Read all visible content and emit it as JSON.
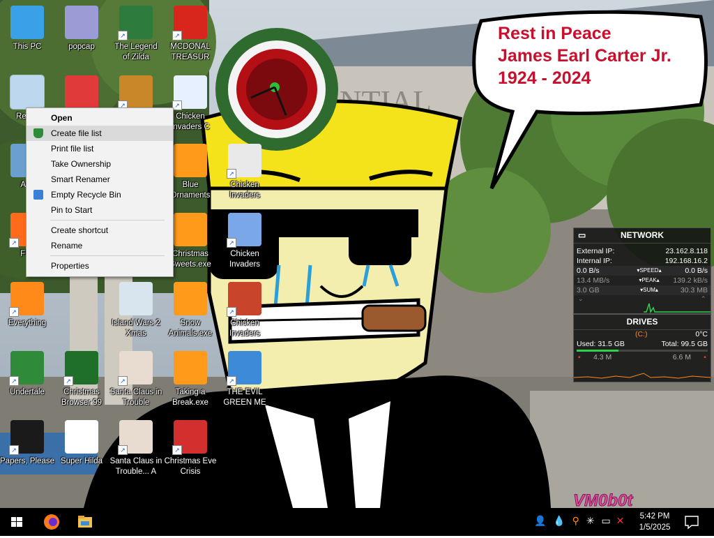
{
  "desktop": {
    "icons": [
      {
        "label": "This PC",
        "icon": "computer-icon",
        "shortcut": false
      },
      {
        "label": "popcap",
        "icon": "folder-icon",
        "shortcut": false
      },
      {
        "label": "The Legend\nof Zilda",
        "icon": "game-icon",
        "shortcut": true
      },
      {
        "label": "MCDONAL\nTREASUR",
        "icon": "mcdonalds-icon",
        "shortcut": true
      },
      {
        "label": "Recyc",
        "icon": "recycle-bin-icon",
        "shortcut": false
      },
      {
        "label": "",
        "icon": "christmas-bird-icon",
        "shortcut": false
      },
      {
        "label": "",
        "icon": "angry-birds-seasons-icon",
        "shortcut": true
      },
      {
        "label": "Chicken\nInvaders C",
        "icon": "snowman-icon",
        "shortcut": true
      },
      {
        "label": "Acti",
        "icon": "app-icon",
        "shortcut": false
      },
      {
        "label": "Blue\nOrnaments",
        "icon": "ornaments-exe-icon",
        "shortcut": false
      },
      {
        "label": "Chicken\nInvaders",
        "icon": "chicken-icon",
        "shortcut": true
      },
      {
        "label": "Fire",
        "icon": "firefox-icon",
        "shortcut": true
      },
      {
        "label": "Christmas\nSweets.exe",
        "icon": "sweets-exe-icon",
        "shortcut": false
      },
      {
        "label": "Chicken\nInvaders",
        "icon": "chicken-invaders-icon",
        "shortcut": true
      },
      {
        "label": "Everything",
        "icon": "everything-search-icon",
        "shortcut": true
      },
      {
        "label": "Island Wars 2\nXmas",
        "icon": "island-wars-icon",
        "shortcut": false
      },
      {
        "label": "Snow\nAnimals.exe",
        "icon": "snow-animals-exe-icon",
        "shortcut": false
      },
      {
        "label": "Chicken\nInvaders",
        "icon": "chicken-invaders-3-icon",
        "shortcut": true
      },
      {
        "label": "Undertale",
        "icon": "undertale-icon",
        "shortcut": true
      },
      {
        "label": "Christmas\nBrowser 99",
        "icon": "christmas-tree-icon",
        "shortcut": true
      },
      {
        "label": "Santa Claus in\nTrouble",
        "icon": "santa-icon",
        "shortcut": true
      },
      {
        "label": "Taking a\nBreak.exe",
        "icon": "break-exe-icon",
        "shortcut": false
      },
      {
        "label": "THE EVIL\nGREEN ME",
        "icon": "evil-green-icon",
        "shortcut": true
      },
      {
        "label": "Papers, Please",
        "icon": "papers-please-icon",
        "shortcut": true
      },
      {
        "label": "Super Hilda",
        "icon": "super-hilda-icon",
        "shortcut": false
      },
      {
        "label": "Santa Claus in\nTrouble... A",
        "icon": "santa-2-icon",
        "shortcut": true
      },
      {
        "label": "Christmas Eve\nCrisis",
        "icon": "santa-3-icon",
        "shortcut": true
      }
    ]
  },
  "context_menu": {
    "items": [
      {
        "label": "Open",
        "bold": true
      },
      {
        "label": "Create file list",
        "hover": true,
        "icon": "tree-cursor-icon"
      },
      {
        "label": "Print file list"
      },
      {
        "label": "Take Ownership"
      },
      {
        "label": "Smart Renamer"
      },
      {
        "label": "Empty Recycle Bin",
        "icon": "recycle-small-icon"
      },
      {
        "label": "Pin to Start"
      },
      {
        "separator": true
      },
      {
        "label": "Create shortcut"
      },
      {
        "label": "Rename"
      },
      {
        "separator": true
      },
      {
        "label": "Properties"
      }
    ]
  },
  "speech_bubble": {
    "line1": "Rest in Peace",
    "line2": "James Earl Carter Jr.",
    "line3": "1924 - 2024"
  },
  "network_gadget": {
    "title": "NETWORK",
    "external_ip_label": "External IP:",
    "external_ip": "23.162.8.118",
    "internal_ip_label": "Internal IP:",
    "internal_ip": "192.168.16.2",
    "speed_down": "0.0 B/s",
    "speed_label": "SPEED",
    "speed_up": "0.0 B/s",
    "peak_down": "13.4 MB/s",
    "peak_label": "PEAK",
    "peak_up": "139.2 kB/s",
    "sum_down": "3.0 GB",
    "sum_label": "SUM",
    "sum_up": "30.3 MB"
  },
  "drives_gadget": {
    "title": "DRIVES",
    "drive": "(C:)",
    "temp": "0°C",
    "used": "Used: 31.5 GB",
    "total": "Total: 99.5 GB",
    "read": "4.3 M",
    "write": "6.6 M",
    "used_fraction": 0.32
  },
  "watermark": "VM0b0t",
  "taskbar": {
    "time": "5:42 PM",
    "date": "1/5/2025"
  },
  "colors": {
    "speech": "#c8102e",
    "taskbar": "#000000"
  }
}
